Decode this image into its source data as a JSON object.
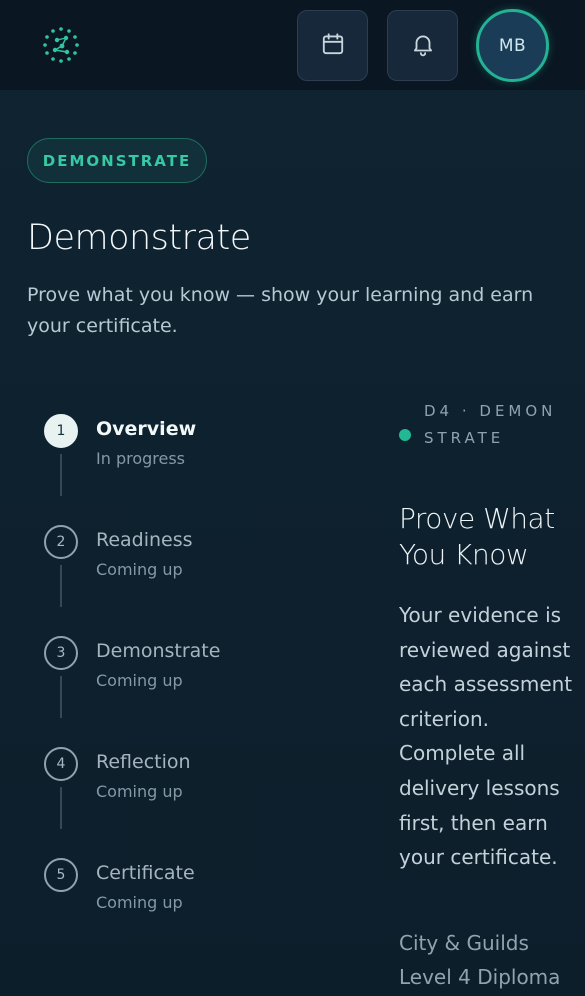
{
  "header": {
    "logo_icon": "network-dots-icon",
    "calendar_icon": "calendar-icon",
    "bell_icon": "bell-icon",
    "avatar_initials": "MB"
  },
  "phase_pill": "DEMONSTRATE",
  "page_title": "Demonstrate",
  "page_subtitle": "Prove what you know — show your learning and earn your certificate.",
  "steps": [
    {
      "number": "1",
      "title": "Overview",
      "status": "In progress",
      "active": true
    },
    {
      "number": "2",
      "title": "Readiness",
      "status": "Coming up",
      "active": false
    },
    {
      "number": "3",
      "title": "Demonstrate",
      "status": "Coming up",
      "active": false
    },
    {
      "number": "4",
      "title": "Reflection",
      "status": "Coming up",
      "active": false
    },
    {
      "number": "5",
      "title": "Certificate",
      "status": "Coming up",
      "active": false
    }
  ],
  "detail": {
    "phase_label": "D4 · DEMONSTRATE",
    "title": "Prove What You Know",
    "body": "Your evidence is reviewed against each assessment criterion. Complete all delivery lessons first, then earn your certificate.",
    "footer": "City & Guilds Level 4 Diploma"
  },
  "colors": {
    "accent": "#22b894",
    "background": "#0d1e2b",
    "header": "#0a1722"
  }
}
